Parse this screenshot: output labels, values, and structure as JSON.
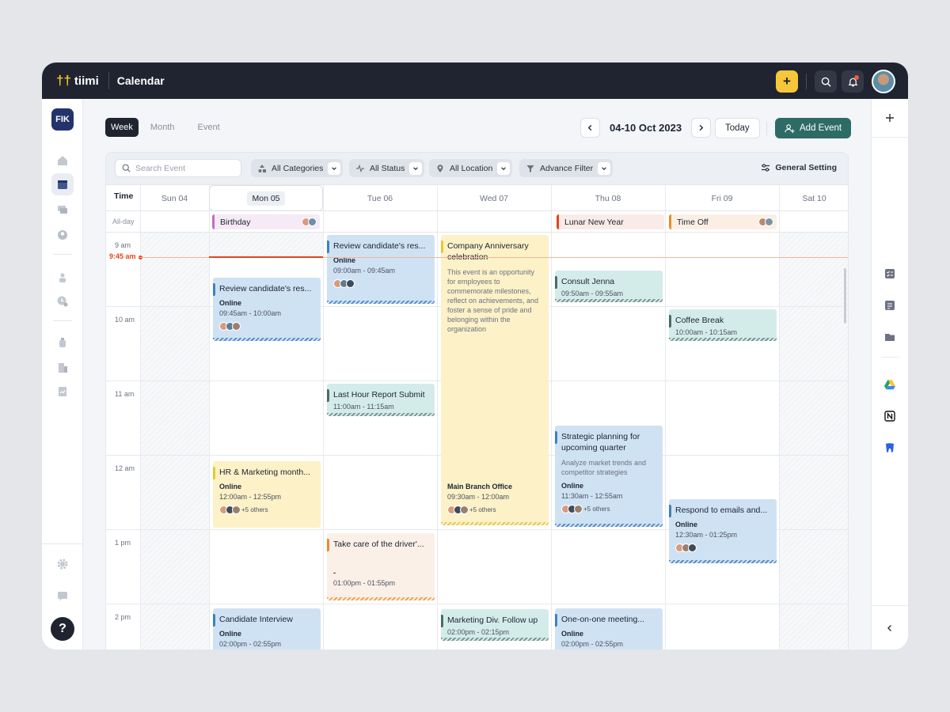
{
  "brand": {
    "name": "tiimi",
    "workspace": "FIK"
  },
  "page_title": "Calendar",
  "view_tabs": [
    "Week",
    "Month",
    "Event"
  ],
  "date_range": "04-10 Oct 2023",
  "buttons": {
    "today": "Today",
    "add_event": "Add Event"
  },
  "search": {
    "placeholder": "Search Event"
  },
  "filters": [
    "All Categories",
    "All Status",
    "All Location",
    "Advance Filter"
  ],
  "general_setting": "General Setting",
  "grid": {
    "time_header": "Time",
    "allday_label": "All-day",
    "days": [
      "Sun 04",
      "Mon 05",
      "Tue 06",
      "Wed 07",
      "Thu 08",
      "Fri 09",
      "Sat 10"
    ],
    "hours": [
      "9 am",
      "10 am",
      "11 am",
      "12 am",
      "1 pm",
      "2 pm"
    ],
    "now_label": "9:45 am"
  },
  "allday_events": [
    {
      "title": "Birthday",
      "color": "#c06fc4"
    },
    {
      "title": "Lunar New Year",
      "color": "#e2471c"
    },
    {
      "title": "Time Off",
      "color": "#ee8a2d"
    }
  ],
  "events": {
    "mon_review": {
      "title": "Review candidate's res...",
      "sub": "Online",
      "time": "09:45am - 10:00am"
    },
    "mon_hr": {
      "title": "HR & Marketing month...",
      "sub": "Online",
      "time": "12:00am - 12:55pm",
      "more": "+5 others"
    },
    "mon_interview": {
      "title": "Candidate Interview",
      "sub": "Online",
      "time": "02:00pm - 02:55pm"
    },
    "tue_review": {
      "title": "Review candidate's res...",
      "sub": "Online",
      "time": "09:00am - 09:45am"
    },
    "tue_report": {
      "title": "Last Hour Report Submit",
      "time": "11:00am - 11:15am"
    },
    "tue_driver": {
      "title": "Take care of the driver'...",
      "sub": "-",
      "time": "01:00pm - 01:55pm"
    },
    "wed_anniv": {
      "title": "Company Anniversary celebration",
      "desc": "This event is an opportunity for employees to commemorate milestones, reflect on achievements, and foster a sense of pride and belonging within the organization",
      "sub": "Main Branch Office",
      "time": "09:30am - 12:00am",
      "more": "+5 others"
    },
    "wed_marketing": {
      "title": "Marketing Div. Follow up",
      "time": "02:00pm - 02:15pm"
    },
    "thu_consult": {
      "title": "Consult Jenna",
      "time": "09:50am - 09:55am"
    },
    "thu_strategic": {
      "title": "Strategic planning for upcoming quarter",
      "desc": "Analyze market trends and competitor strategies",
      "sub": "Online",
      "time": "11:30am - 12:55am",
      "more": "+5 others"
    },
    "thu_oneonone": {
      "title": "One-on-one meeting...",
      "sub": "Online",
      "time": "02:00pm - 02:55pm"
    },
    "fri_coffee": {
      "title": "Coffee Break",
      "time": "10:00am - 10:15am"
    },
    "fri_emails": {
      "title": "Respond to emails and...",
      "sub": "Online",
      "time": "12:30am - 01:25pm"
    }
  },
  "colors": {
    "accent": "#2f6b66",
    "topbar": "#1f2430",
    "now": "#e2471c",
    "add": "#f6c73a"
  }
}
